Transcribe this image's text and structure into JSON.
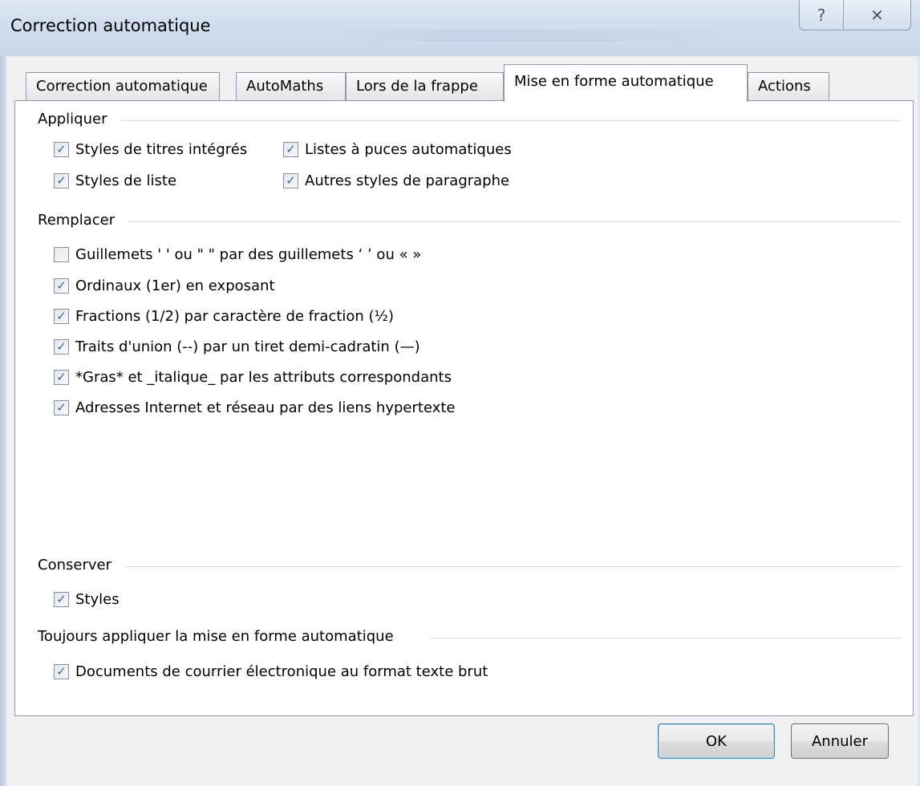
{
  "window": {
    "title": "Correction automatique",
    "help_glyph": "?",
    "close_glyph": "✕"
  },
  "tabs": [
    {
      "label": "Correction automatique"
    },
    {
      "label": "AutoMaths"
    },
    {
      "label": "Lors de la frappe"
    },
    {
      "label": "Mise en forme automatique",
      "active": true
    },
    {
      "label": "Actions"
    }
  ],
  "groups": {
    "appliquer": "Appliquer",
    "remplacer": "Remplacer",
    "conserver": "Conserver",
    "toujours": "Toujours appliquer la mise en forme automatique"
  },
  "options": {
    "styles_titres": {
      "label": "Styles de titres intégrés",
      "checked": true
    },
    "listes_puces": {
      "label": "Listes à puces automatiques",
      "checked": true
    },
    "styles_liste": {
      "label": "Styles de liste",
      "checked": true
    },
    "autres_styles": {
      "label": "Autres styles de paragraphe",
      "checked": true
    },
    "guillemets": {
      "label": "Guillemets ' ' ou \" \" par des guillemets ‘ ’ ou « »",
      "checked": false
    },
    "ordinaux": {
      "label": "Ordinaux (1er) en exposant",
      "checked": true
    },
    "fractions": {
      "label": "Fractions (1/2) par caractère de fraction (½)",
      "checked": true
    },
    "traits": {
      "label": "Traits d'union (--) par un tiret demi-cadratin (—)",
      "checked": true
    },
    "gras": {
      "label": "*Gras* et _italique_ par les attributs correspondants",
      "checked": true
    },
    "adresses": {
      "label": "Adresses Internet et réseau par des liens hypertexte",
      "checked": true
    },
    "styles": {
      "label": "Styles",
      "checked": true
    },
    "documents": {
      "label": "Documents de courrier électronique au format texte brut",
      "checked": true
    }
  },
  "buttons": {
    "ok": "OK",
    "annuler": "Annuler"
  },
  "check_glyph": "✓"
}
